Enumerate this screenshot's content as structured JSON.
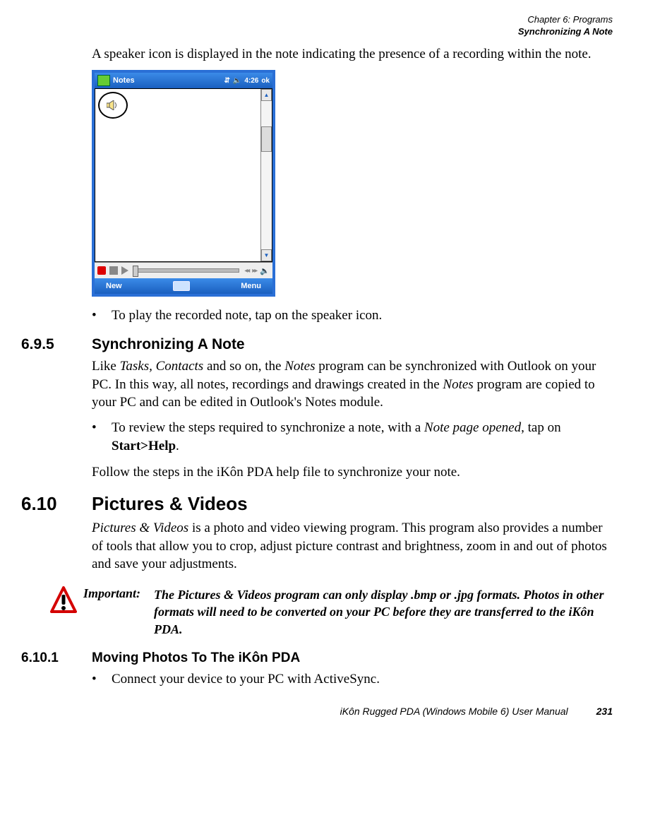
{
  "header": {
    "chapter": "Chapter 6: Programs",
    "section": "Synchronizing A Note"
  },
  "intro": {
    "p1_a": "A speaker icon is displayed in the note indicating the presence of a recording within the note."
  },
  "device": {
    "title": "Notes",
    "time": "4:26",
    "ok": "ok",
    "soft_left": "New",
    "soft_right": "Menu"
  },
  "bullet1": "To play the recorded note, tap on the speaker icon.",
  "s695": {
    "num": "6.9.5",
    "title": "Synchronizing A Note",
    "p1_pre": "Like ",
    "p1_i1": "Tasks, Contacts",
    "p1_mid1": " and so on, the ",
    "p1_i2": "Notes",
    "p1_mid2": " program can be synchronized with Outlook on your PC. In this way, all notes, recordings and drawings created in the ",
    "p1_i3": "Notes",
    "p1_mid3": " program are copied to your PC and can be edited in Outlook's Notes module.",
    "b1_pre": "To review the steps required to synchronize a note, with a ",
    "b1_i": "Note page opened",
    "b1_mid": ", tap on ",
    "b1_bold": "Start>Help",
    "b1_post": ".",
    "p2": "Follow the steps in the iKôn PDA help file to synchronize your note."
  },
  "s610": {
    "num": "6.10",
    "title": "Pictures & Videos",
    "p1_i": "Pictures & Videos",
    "p1_rest": " is a photo and video viewing program. This program also provides a number of tools that allow you to crop, adjust picture contrast and brightness, zoom in and out of photos and save your adjustments."
  },
  "important": {
    "label": "Important:",
    "body": "The Pictures & Videos program can only display .bmp or .jpg formats. Photos in other formats will need to be converted on your PC before they are transferred to the iKôn PDA."
  },
  "s6101": {
    "num": "6.10.1",
    "title": "Moving Photos To The iKôn PDA",
    "b1": "Connect your device to your PC with ActiveSync."
  },
  "footer": {
    "title": "iKôn Rugged PDA (Windows Mobile 6) User Manual",
    "page": "231"
  },
  "glyphs": {
    "bullet": "•",
    "signal": "⇵",
    "speaker": "🔈",
    "rew": "◂◂",
    "fwd": "▸▸"
  }
}
